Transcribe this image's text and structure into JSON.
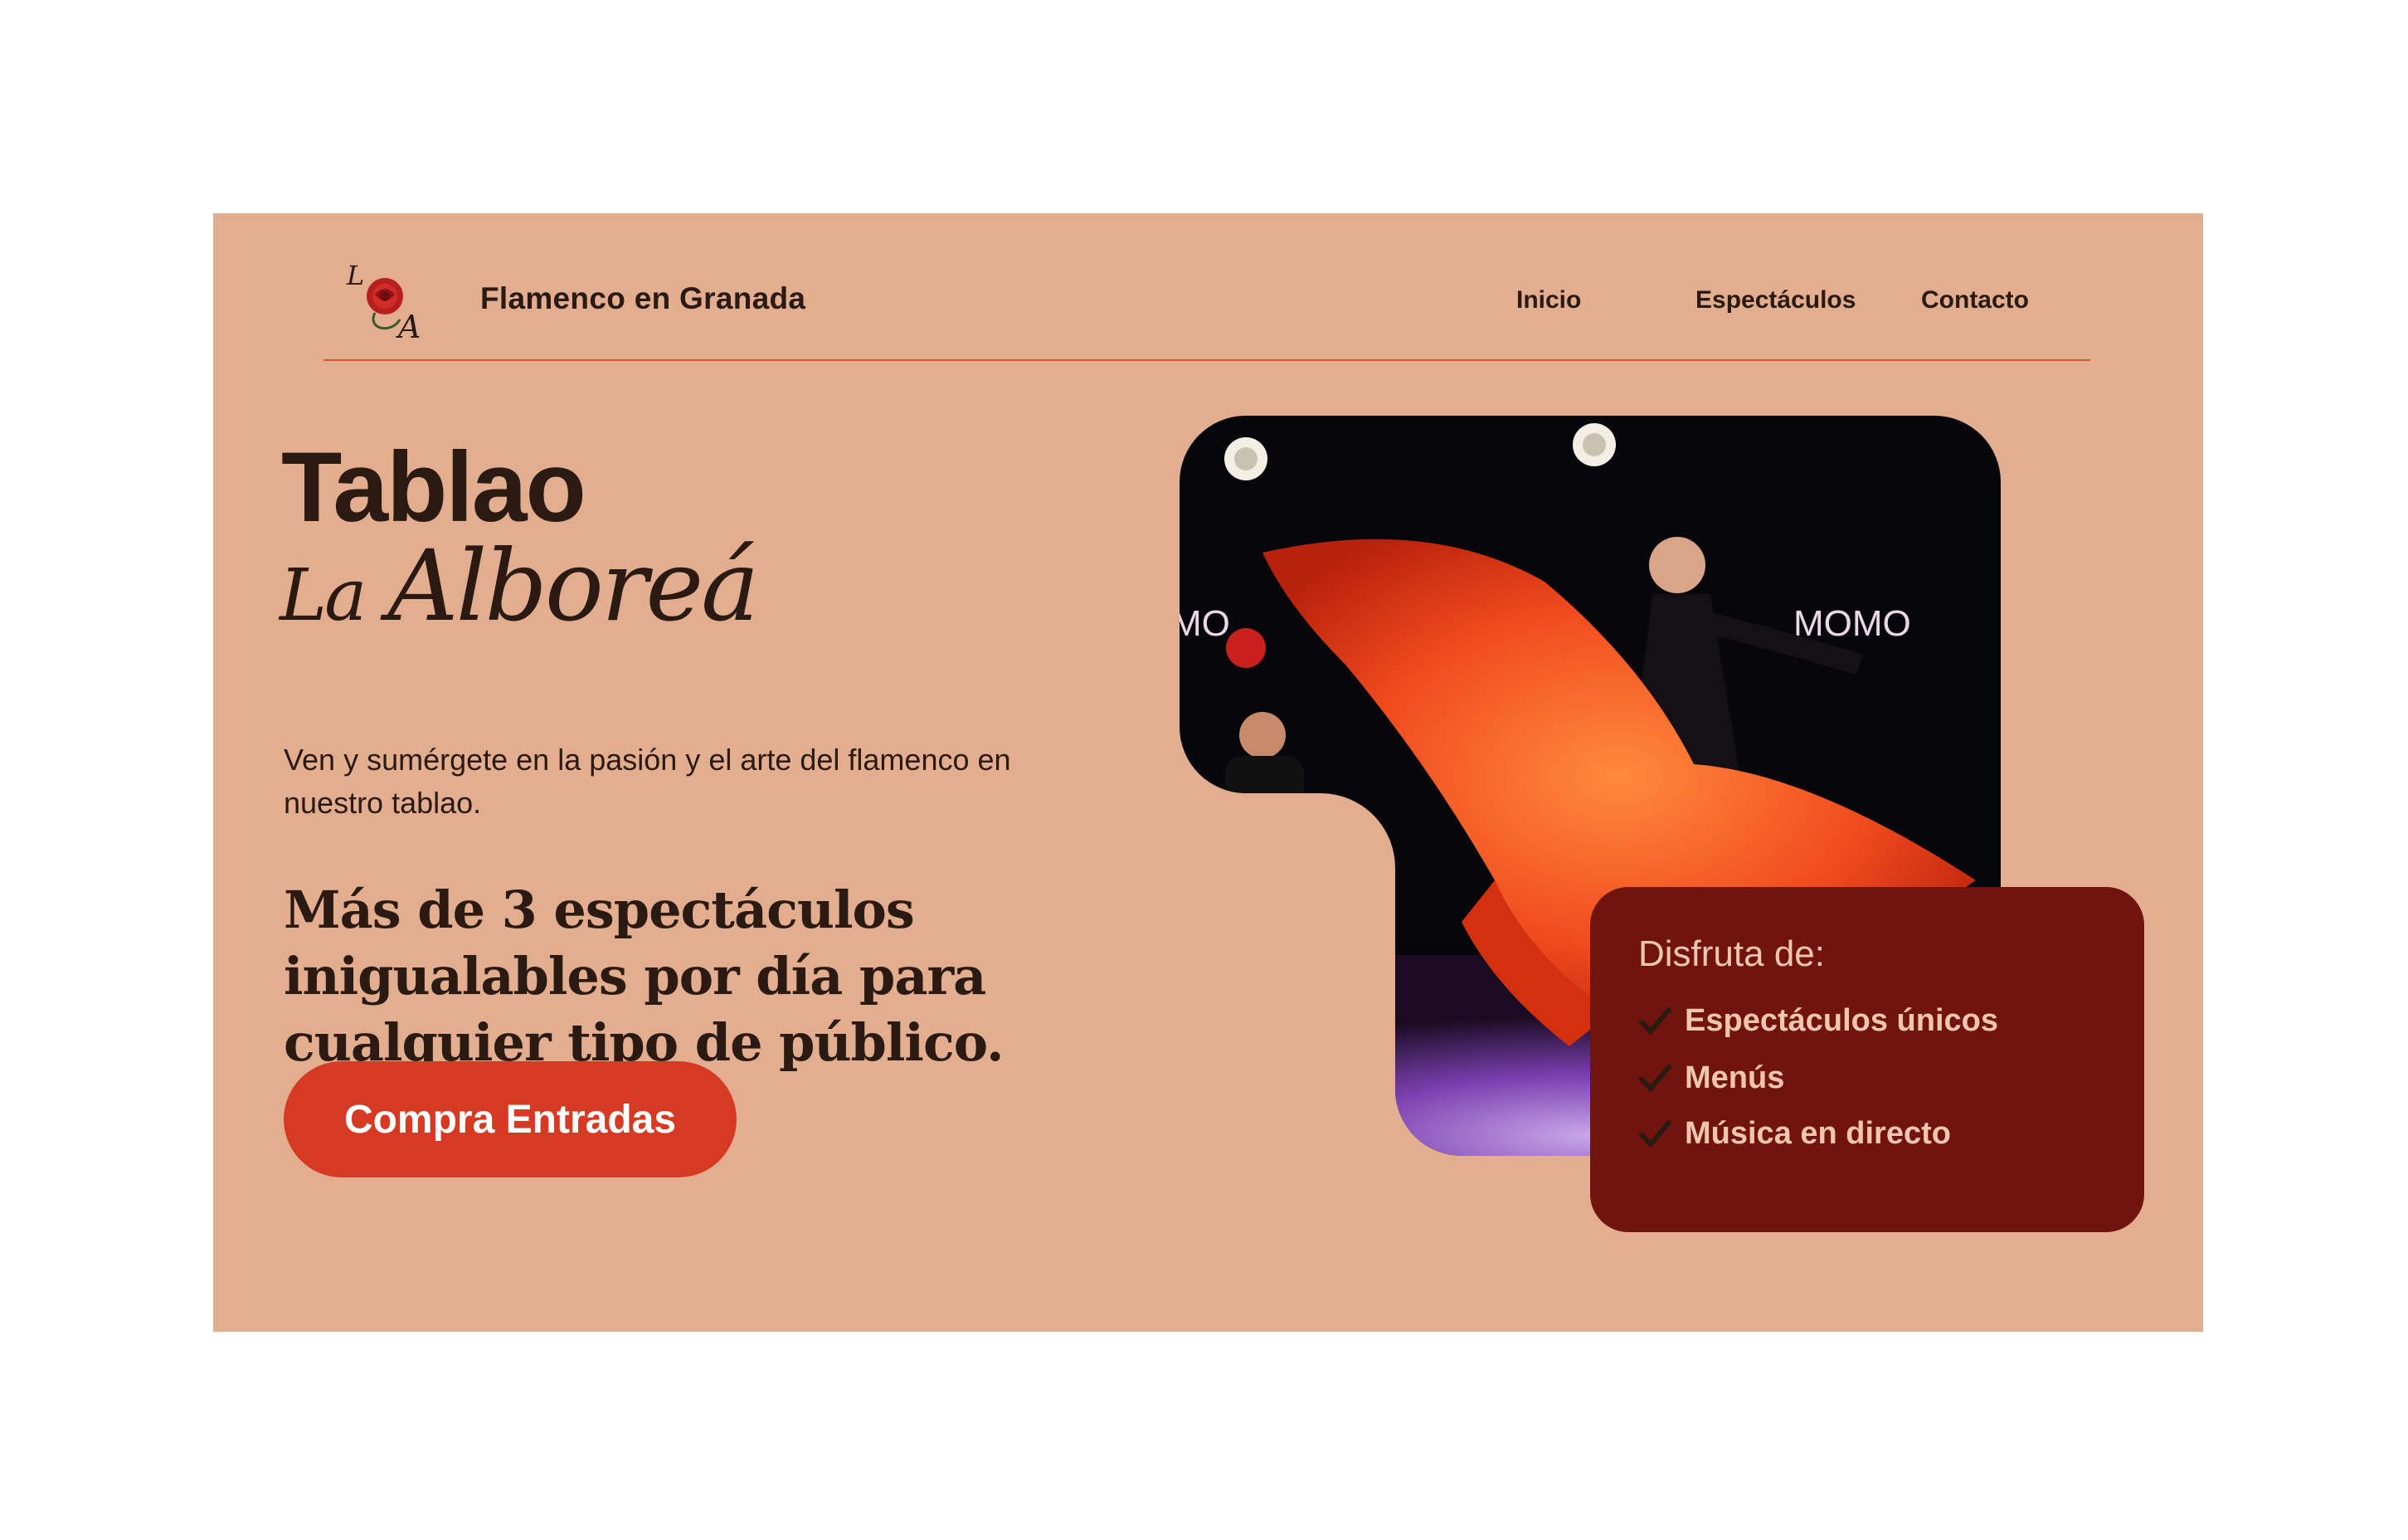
{
  "header": {
    "brand": "Flamenco en Granada",
    "logo_icon": "rose-monogram-logo",
    "nav": [
      {
        "label": "Inicio"
      },
      {
        "label": "Espectáculos"
      },
      {
        "label": "Contacto"
      }
    ]
  },
  "hero": {
    "title_line1": "Tablao",
    "title_line2_small": "La",
    "title_line2_large": "Alboreá",
    "intro": "Ven y sumérgete en la pasión y el arte del flamenco en nuestro tablao.",
    "tagline": "Más de 3 espectáculos inigualables por día para cualquier tipo de público.",
    "cta_label": "Compra Entradas"
  },
  "features": {
    "title": "Disfruta de:",
    "items": [
      {
        "label": "Espectáculos únicos",
        "icon": "check-icon"
      },
      {
        "label": "Menús",
        "icon": "check-icon"
      },
      {
        "label": "Música en directo",
        "icon": "check-icon"
      }
    ]
  },
  "colors": {
    "background": "#e2ae8f",
    "accent": "#d63a23",
    "card": "#71130e",
    "text": "#2b1a12"
  }
}
